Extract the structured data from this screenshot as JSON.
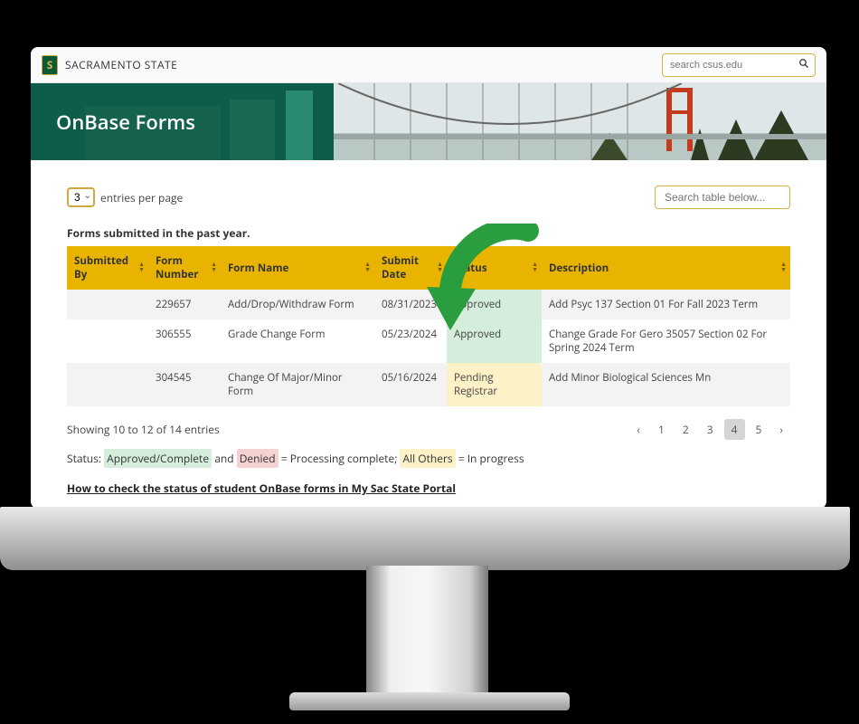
{
  "brand": "SACRAMENTO STATE",
  "search": {
    "placeholder": "search csus.edu"
  },
  "hero": {
    "title": "OnBase Forms"
  },
  "entries": {
    "value": "3",
    "label": "entries per page"
  },
  "tableSearch": {
    "placeholder": "Search table below..."
  },
  "caption": "Forms submitted in the past year.",
  "columns": {
    "submittedBy": "Submitted By",
    "formNumber": "Form Number",
    "formName": "Form Name",
    "submitDate": "Submit Date",
    "status": "Status",
    "description": "Description"
  },
  "rows": [
    {
      "submittedBy": "",
      "formNumber": "229657",
      "formName": "Add/Drop/Withdraw Form",
      "submitDate": "08/31/2023",
      "status": "Approved",
      "statusClass": "approved",
      "description": "Add Psyc 137 Section 01 For Fall 2023 Term"
    },
    {
      "submittedBy": "",
      "formNumber": "306555",
      "formName": "Grade Change Form",
      "submitDate": "05/23/2024",
      "status": "Approved",
      "statusClass": "approved",
      "description": "Change Grade For Gero 35057 Section 02 For Spring 2024 Term"
    },
    {
      "submittedBy": "",
      "formNumber": "304545",
      "formName": "Change Of Major/Minor Form",
      "submitDate": "05/16/2024",
      "status": "Pending Registrar",
      "statusClass": "pending",
      "description": "Add Minor Biological Sciences Mn"
    }
  ],
  "showing": "Showing 10 to 12 of 14 entries",
  "pagination": {
    "prev": "‹",
    "pages": [
      "1",
      "2",
      "3",
      "4",
      "5"
    ],
    "active": "4",
    "next": "›"
  },
  "legend": {
    "prefix": "Status:",
    "approved": "Approved/Complete",
    "and": "and",
    "denied": "Denied",
    "eqComplete": "= Processing complete;",
    "others": "All Others",
    "eqProgress": "= In progress"
  },
  "howto": "How to check the status of student OnBase forms in My Sac State Portal"
}
